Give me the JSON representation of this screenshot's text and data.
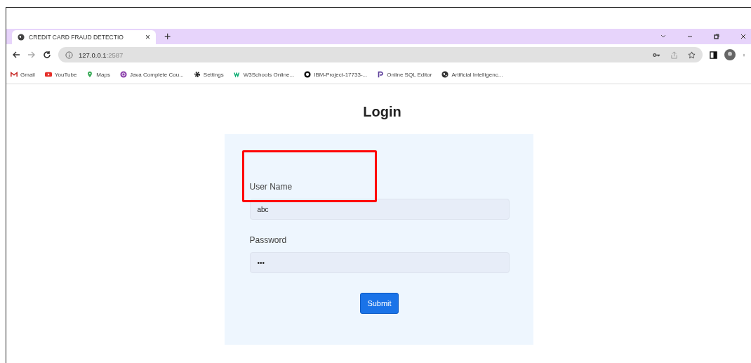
{
  "browser": {
    "tab": {
      "title": "CREDIT CARD FRAUD DETECTIO",
      "close": "×",
      "selected": true
    },
    "new_tab": "+",
    "url_host": "127.0.0.1",
    "url_port": ":2587",
    "bookmarks": [
      {
        "label": "Gmail",
        "kind": "gmail"
      },
      {
        "label": "YouTube",
        "kind": "youtube"
      },
      {
        "label": "Maps",
        "kind": "maps"
      },
      {
        "label": "Java Complete Cou...",
        "kind": "course"
      },
      {
        "label": "Settings",
        "kind": "gear"
      },
      {
        "label": "W3Schools Online...",
        "kind": "w3"
      },
      {
        "label": "IBM-Project-17733-...",
        "kind": "github"
      },
      {
        "label": "Online SQL Editor",
        "kind": "sql"
      },
      {
        "label": "Artificial Intelligenc...",
        "kind": "globe"
      }
    ]
  },
  "page": {
    "title": "Login",
    "form": {
      "fields": [
        {
          "label": "User Name",
          "value": "abc"
        },
        {
          "label": "Password",
          "value": "•••"
        }
      ],
      "submit": "Submit"
    },
    "highlight": {
      "kind": "annotation"
    }
  }
}
